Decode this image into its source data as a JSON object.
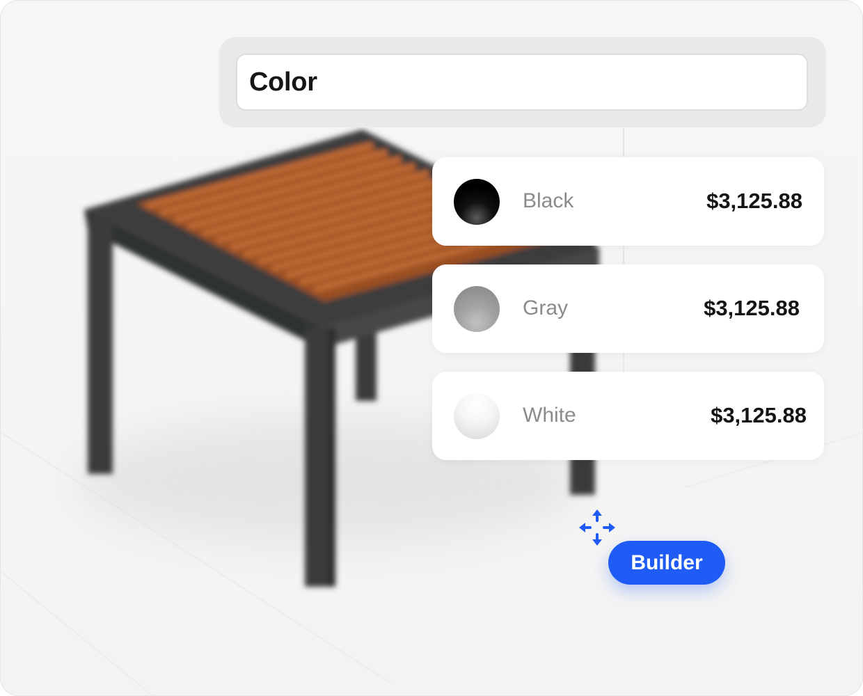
{
  "header": {
    "title": "Color"
  },
  "options": [
    {
      "name": "Black",
      "price": "$3,125.88",
      "swatch_color": "#0a0a0a"
    },
    {
      "name": "Gray",
      "price": "$3,125.88",
      "swatch_color": "#9e9e9e"
    },
    {
      "name": "White",
      "price": "$3,125.88",
      "swatch_color": "#f2f2f2"
    }
  ],
  "builder": {
    "label": "Builder",
    "icon": "move-arrows-icon"
  },
  "colors": {
    "accent": "#1e5cf5",
    "frame_color": "#3a3b3b",
    "slat_color": "#a8582a",
    "background": "#f7f7f7"
  }
}
